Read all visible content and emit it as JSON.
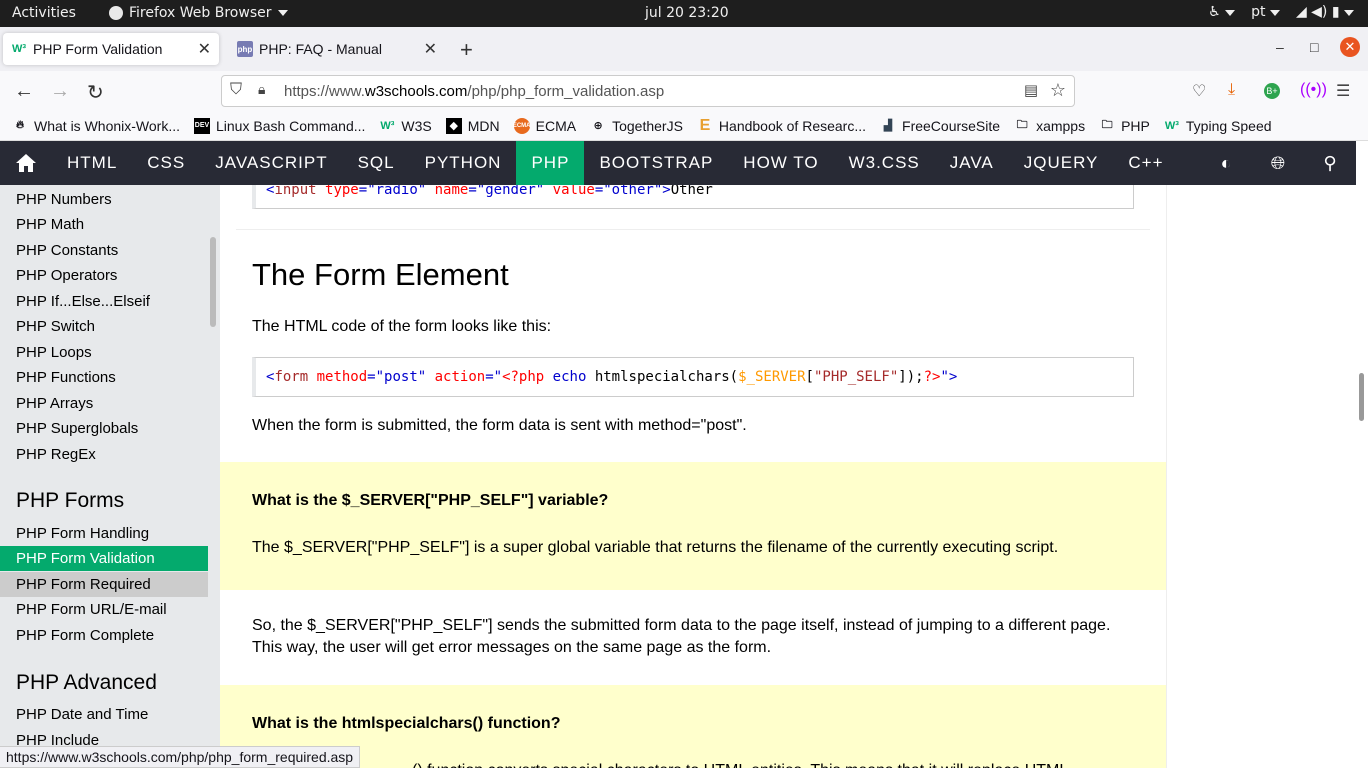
{
  "system": {
    "activities": "Activities",
    "app_name": "Firefox Web Browser",
    "clock": "jul 20  23:20",
    "language": "pt"
  },
  "tabs": [
    {
      "title": "PHP Form Validation",
      "icon": "w3schools-icon",
      "active": true
    },
    {
      "title": "PHP: FAQ - Manual",
      "icon": "php-icon",
      "active": false
    }
  ],
  "navbar": {
    "url_prefix": "https://www.",
    "url_domain": "w3schools.com",
    "url_path": "/php/php_form_validation.asp"
  },
  "bookmarks": [
    {
      "label": "What is Whonix-Work...",
      "icon": "whonix-icon"
    },
    {
      "label": "Linux Bash Command...",
      "icon": "dev-icon"
    },
    {
      "label": "W3S",
      "icon": "w3schools-icon"
    },
    {
      "label": "MDN",
      "icon": "mdn-icon"
    },
    {
      "label": "ECMA",
      "icon": "ecma-icon"
    },
    {
      "label": "TogetherJS",
      "icon": "globe-icon"
    },
    {
      "label": "Handbook of Researc...",
      "icon": "e-icon"
    },
    {
      "label": "FreeCourseSite",
      "icon": "fcs-icon"
    },
    {
      "label": "xampps",
      "icon": "folder-icon"
    },
    {
      "label": "PHP",
      "icon": "folder-icon"
    },
    {
      "label": "Typing Speed",
      "icon": "w3schools-icon"
    }
  ],
  "w3nav": {
    "items": [
      "HTML",
      "CSS",
      "JAVASCRIPT",
      "SQL",
      "PYTHON",
      "PHP",
      "BOOTSTRAP",
      "HOW TO",
      "W3.CSS",
      "JAVA",
      "JQUERY",
      "C++"
    ],
    "active": "PHP"
  },
  "sidebar": {
    "basic_items": [
      "PHP Numbers",
      "PHP Math",
      "PHP Constants",
      "PHP Operators",
      "PHP If...Else...Elseif",
      "PHP Switch",
      "PHP Loops",
      "PHP Functions",
      "PHP Arrays",
      "PHP Superglobals",
      "PHP RegEx"
    ],
    "forms_heading": "PHP Forms",
    "forms_items": [
      "PHP Form Handling",
      "PHP Form Validation",
      "PHP Form Required",
      "PHP Form URL/E-mail",
      "PHP Form Complete"
    ],
    "advanced_heading": "PHP Advanced",
    "advanced_items": [
      "PHP Date and Time",
      "PHP Include"
    ]
  },
  "main": {
    "code1": {
      "open": "<",
      "el": "input",
      "a1": " type",
      "eq": "=",
      "v1": "\"radio\"",
      "a2": " name",
      "v2": "\"gender\"",
      "a3": " value",
      "v3": "\"other\"",
      "close": ">",
      "text": "Other"
    },
    "heading": "The Form Element",
    "intro": "The HTML code of the form looks like this:",
    "code2": {
      "open": "<",
      "el": "form",
      "a1": " method",
      "eq": "=",
      "v1": "\"post\"",
      "a2": " action",
      "q": "\"",
      "php_open": "<?php",
      "echo": " echo",
      "fn": " htmlspecialchars(",
      "var": "$_SERVER",
      "br_open": "[",
      "key": "\"PHP_SELF\"",
      "br_close": "]);",
      "php_close": "?>",
      "q2": "\"",
      "close": ">"
    },
    "submit_text": "When the form is submitted, the form data is sent with method=\"post\".",
    "note1_q": "What is the $_SERVER[\"PHP_SELF\"] variable?",
    "note1_a": "The $_SERVER[\"PHP_SELF\"] is a super global variable that returns the filename of the currently executing script.",
    "self_text": "So, the $_SERVER[\"PHP_SELF\"] sends the submitted form data to the page itself, instead of jumping to a different page. This way, the user will get error messages on the same page as the form.",
    "note2_q": "What is the htmlspecialchars() function?",
    "note2_partial": "() function converts special characters to HTML entities. This means that it will replace HTML"
  },
  "status_url": "https://www.w3schools.com/php/php_form_required.asp"
}
